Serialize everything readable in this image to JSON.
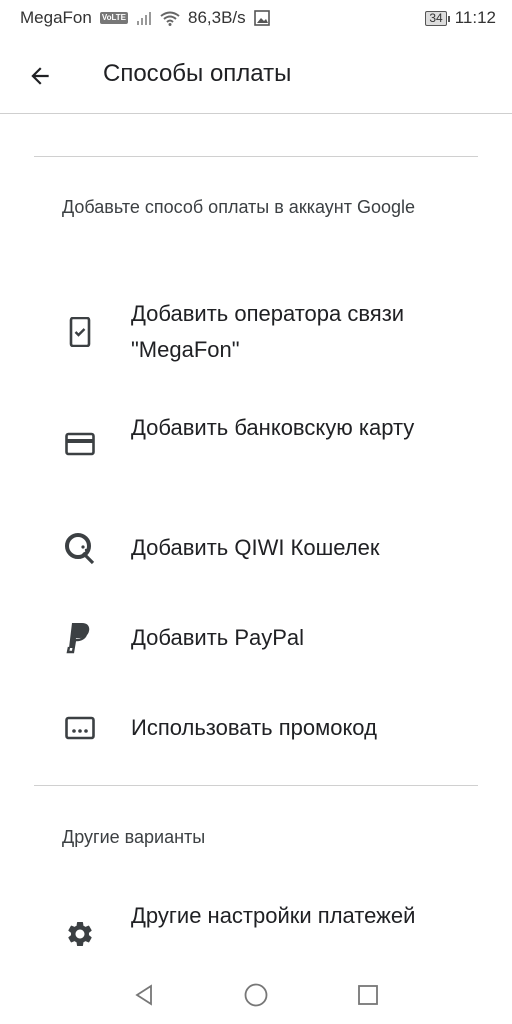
{
  "status_bar": {
    "carrier": "MegaFon",
    "volte": "VoLTE",
    "speed": "86,3B/s",
    "battery": "34",
    "time": "11:12"
  },
  "app_bar": {
    "title": "Способы оплаты"
  },
  "add_section": {
    "title": "Добавьте способ оплаты в аккаунт Google",
    "items": [
      {
        "label": "Добавить оператора связи \"MegaFon\"",
        "icon": "phone-check-icon"
      },
      {
        "label": "Добавить банковскую карту",
        "icon": "credit-card-icon"
      },
      {
        "label": "Добавить QIWI Кошелек",
        "icon": "qiwi-icon"
      },
      {
        "label": "Добавить PayPal",
        "icon": "paypal-icon"
      },
      {
        "label": "Использовать промокод",
        "icon": "promo-code-icon"
      }
    ]
  },
  "other_section": {
    "title": "Другие варианты",
    "items": [
      {
        "label": "Другие настройки платежей",
        "icon": "gear-icon"
      }
    ]
  },
  "colors": {
    "text": "#202124",
    "icon": "#3c4043",
    "divider": "#d0d0d0"
  }
}
